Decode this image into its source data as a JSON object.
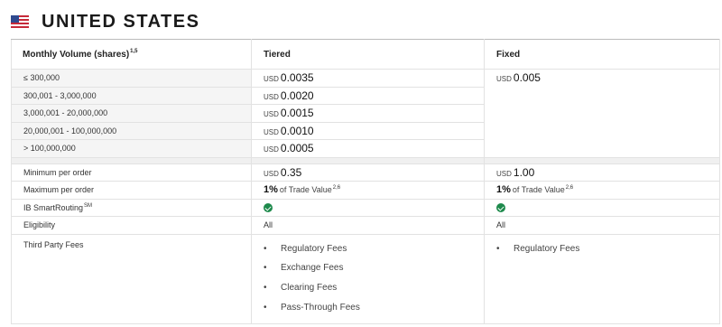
{
  "heading": {
    "title": "UNITED STATES",
    "flag_icon": "us-flag-icon"
  },
  "table": {
    "columns": {
      "volume": "Monthly Volume (shares)",
      "volume_sup": "1,5",
      "tiered": "Tiered",
      "fixed": "Fixed"
    },
    "tiers": [
      {
        "volume": "≤ 300,000",
        "currency": "USD",
        "rate": "0.0035"
      },
      {
        "volume": "300,001 - 3,000,000",
        "currency": "USD",
        "rate": "0.0020"
      },
      {
        "volume": "3,000,001 - 20,000,000",
        "currency": "USD",
        "rate": "0.0015"
      },
      {
        "volume": "20,000,001 - 100,000,000",
        "currency": "USD",
        "rate": "0.0010"
      },
      {
        "volume": "> 100,000,000",
        "currency": "USD",
        "rate": "0.0005"
      }
    ],
    "fixed_rate": {
      "currency": "USD",
      "rate": "0.005"
    },
    "min_order": {
      "label": "Minimum per order",
      "tiered": {
        "currency": "USD",
        "amount": "0.35"
      },
      "fixed": {
        "currency": "USD",
        "amount": "1.00"
      }
    },
    "max_order": {
      "label": "Maximum per order",
      "tiered": {
        "pct": "1%",
        "text": "of Trade Value",
        "sup": "2,6"
      },
      "fixed": {
        "pct": "1%",
        "text": "of Trade Value",
        "sup": "2,6"
      }
    },
    "smart_routing": {
      "label": "IB SmartRouting",
      "sup": "SM",
      "icon": "check-circle-icon"
    },
    "eligibility": {
      "label": "Eligibility",
      "tiered": "All",
      "fixed": "All"
    },
    "third_party": {
      "label": "Third Party Fees",
      "tiered": [
        "Regulatory Fees",
        "Exchange Fees",
        "Clearing Fees",
        "Pass-Through Fees"
      ],
      "fixed": [
        "Regulatory Fees"
      ],
      "bullet": "•"
    }
  },
  "colors": {
    "check_green": "#1e8a4c",
    "tier_row_bg": "#f5f5f5"
  }
}
